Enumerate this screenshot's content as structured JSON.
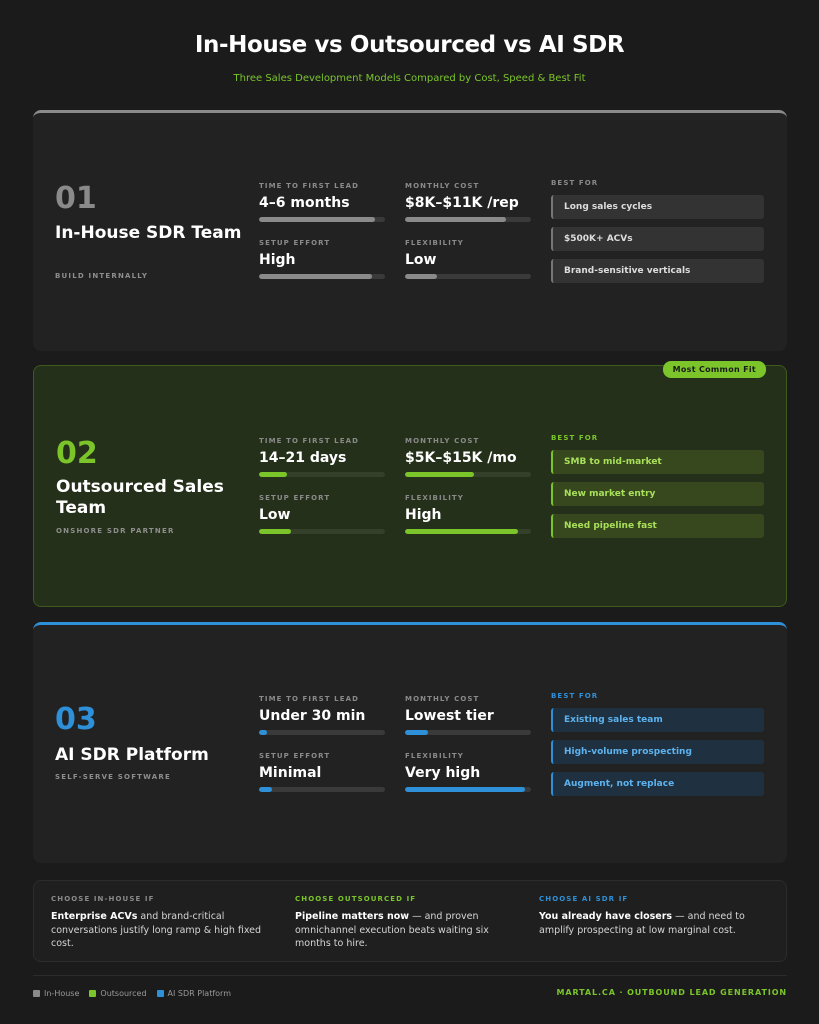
{
  "title": "In-House vs Outsourced vs AI SDR",
  "subtitle": "Three Sales Development Models Compared by Cost, Speed & Best Fit",
  "colors": {
    "inhouse": "#8a8a8a",
    "outsourced": "#7bc52b",
    "ai": "#2e90d8"
  },
  "cards": [
    {
      "num": "01",
      "name": "In-House SDR Team",
      "sub": "BUILD INTERNALLY",
      "metrics": [
        {
          "label": "TIME TO FIRST LEAD",
          "value": "4–6 months",
          "level": 0.92
        },
        {
          "label": "MONTHLY COST",
          "value": "$8K–$11K /rep",
          "level": 0.8
        },
        {
          "label": "SETUP EFFORT",
          "value": "High",
          "level": 0.9
        },
        {
          "label": "FLEXIBILITY",
          "value": "Low",
          "level": 0.25
        }
      ],
      "best_label": "BEST FOR",
      "best": [
        "Long sales cycles",
        "$500K+ ACVs",
        "Brand-sensitive verticals"
      ]
    },
    {
      "num": "02",
      "name": "Outsourced Sales Team",
      "sub": "ONSHORE SDR PARTNER",
      "badge": "Most Common Fit",
      "metrics": [
        {
          "label": "TIME TO FIRST LEAD",
          "value": "14–21 days",
          "level": 0.22
        },
        {
          "label": "MONTHLY COST",
          "value": "$5K–$15K /mo",
          "level": 0.55
        },
        {
          "label": "SETUP EFFORT",
          "value": "Low",
          "level": 0.25
        },
        {
          "label": "FLEXIBILITY",
          "value": "High",
          "level": 0.9
        }
      ],
      "best_label": "BEST FOR",
      "best": [
        "SMB to mid-market",
        "New market entry",
        "Need pipeline fast"
      ]
    },
    {
      "num": "03",
      "name": "AI SDR Platform",
      "sub": "SELF-SERVE SOFTWARE",
      "metrics": [
        {
          "label": "TIME TO FIRST LEAD",
          "value": "Under 30 min",
          "level": 0.06
        },
        {
          "label": "MONTHLY COST",
          "value": "Lowest tier",
          "level": 0.18
        },
        {
          "label": "SETUP EFFORT",
          "value": "Minimal",
          "level": 0.1
        },
        {
          "label": "FLEXIBILITY",
          "value": "Very high",
          "level": 0.95
        }
      ],
      "best_label": "BEST FOR",
      "best": [
        "Existing sales team",
        "High-volume prospecting",
        "Augment, not replace"
      ]
    }
  ],
  "choose": [
    {
      "label": "CHOOSE IN-HOUSE IF",
      "bold": "Enterprise ACVs",
      "rest": " and brand-critical conversations justify long ramp & high fixed cost."
    },
    {
      "label": "CHOOSE OUTSOURCED IF",
      "bold": "Pipeline matters now",
      "rest": " — and proven omnichannel execution beats waiting six months to hire."
    },
    {
      "label": "CHOOSE AI SDR IF",
      "bold": "You already have closers",
      "rest": " — and need to amplify prospecting at low marginal cost."
    }
  ],
  "legend": [
    "In-House",
    "Outsourced",
    "AI SDR Platform"
  ],
  "footer": "MARTAL.CA · OUTBOUND LEAD GENERATION"
}
